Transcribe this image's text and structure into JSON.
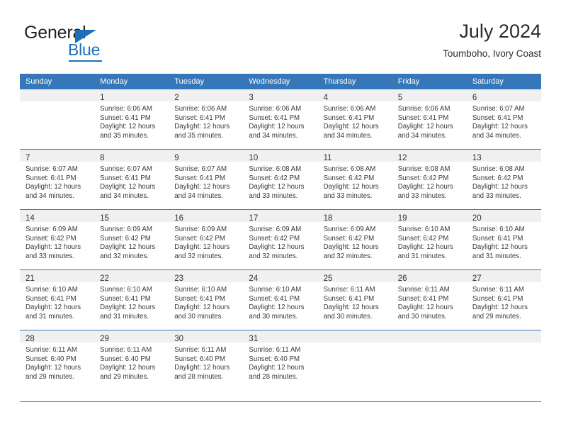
{
  "brand": {
    "name_part1": "General",
    "name_part2": "Blue",
    "logo_icon": "triangle-logo-icon",
    "colors": {
      "blue": "#1d70b7",
      "dark": "#231f20"
    }
  },
  "header": {
    "title": "July 2024",
    "subtitle": "Toumboho, Ivory Coast"
  },
  "calendar": {
    "header_bg": "#3577b9",
    "header_text_color": "#ffffff",
    "daynum_band_bg": "#f0f0f0",
    "weekday_headers": [
      "Sunday",
      "Monday",
      "Tuesday",
      "Wednesday",
      "Thursday",
      "Friday",
      "Saturday"
    ],
    "weeks": [
      [
        {
          "day": "",
          "lines": []
        },
        {
          "day": "1",
          "lines": [
            "Sunrise: 6:06 AM",
            "Sunset: 6:41 PM",
            "Daylight: 12 hours",
            "and 35 minutes."
          ]
        },
        {
          "day": "2",
          "lines": [
            "Sunrise: 6:06 AM",
            "Sunset: 6:41 PM",
            "Daylight: 12 hours",
            "and 35 minutes."
          ]
        },
        {
          "day": "3",
          "lines": [
            "Sunrise: 6:06 AM",
            "Sunset: 6:41 PM",
            "Daylight: 12 hours",
            "and 34 minutes."
          ]
        },
        {
          "day": "4",
          "lines": [
            "Sunrise: 6:06 AM",
            "Sunset: 6:41 PM",
            "Daylight: 12 hours",
            "and 34 minutes."
          ]
        },
        {
          "day": "5",
          "lines": [
            "Sunrise: 6:06 AM",
            "Sunset: 6:41 PM",
            "Daylight: 12 hours",
            "and 34 minutes."
          ]
        },
        {
          "day": "6",
          "lines": [
            "Sunrise: 6:07 AM",
            "Sunset: 6:41 PM",
            "Daylight: 12 hours",
            "and 34 minutes."
          ]
        }
      ],
      [
        {
          "day": "7",
          "lines": [
            "Sunrise: 6:07 AM",
            "Sunset: 6:41 PM",
            "Daylight: 12 hours",
            "and 34 minutes."
          ]
        },
        {
          "day": "8",
          "lines": [
            "Sunrise: 6:07 AM",
            "Sunset: 6:41 PM",
            "Daylight: 12 hours",
            "and 34 minutes."
          ]
        },
        {
          "day": "9",
          "lines": [
            "Sunrise: 6:07 AM",
            "Sunset: 6:41 PM",
            "Daylight: 12 hours",
            "and 34 minutes."
          ]
        },
        {
          "day": "10",
          "lines": [
            "Sunrise: 6:08 AM",
            "Sunset: 6:42 PM",
            "Daylight: 12 hours",
            "and 33 minutes."
          ]
        },
        {
          "day": "11",
          "lines": [
            "Sunrise: 6:08 AM",
            "Sunset: 6:42 PM",
            "Daylight: 12 hours",
            "and 33 minutes."
          ]
        },
        {
          "day": "12",
          "lines": [
            "Sunrise: 6:08 AM",
            "Sunset: 6:42 PM",
            "Daylight: 12 hours",
            "and 33 minutes."
          ]
        },
        {
          "day": "13",
          "lines": [
            "Sunrise: 6:08 AM",
            "Sunset: 6:42 PM",
            "Daylight: 12 hours",
            "and 33 minutes."
          ]
        }
      ],
      [
        {
          "day": "14",
          "lines": [
            "Sunrise: 6:09 AM",
            "Sunset: 6:42 PM",
            "Daylight: 12 hours",
            "and 33 minutes."
          ]
        },
        {
          "day": "15",
          "lines": [
            "Sunrise: 6:09 AM",
            "Sunset: 6:42 PM",
            "Daylight: 12 hours",
            "and 32 minutes."
          ]
        },
        {
          "day": "16",
          "lines": [
            "Sunrise: 6:09 AM",
            "Sunset: 6:42 PM",
            "Daylight: 12 hours",
            "and 32 minutes."
          ]
        },
        {
          "day": "17",
          "lines": [
            "Sunrise: 6:09 AM",
            "Sunset: 6:42 PM",
            "Daylight: 12 hours",
            "and 32 minutes."
          ]
        },
        {
          "day": "18",
          "lines": [
            "Sunrise: 6:09 AM",
            "Sunset: 6:42 PM",
            "Daylight: 12 hours",
            "and 32 minutes."
          ]
        },
        {
          "day": "19",
          "lines": [
            "Sunrise: 6:10 AM",
            "Sunset: 6:42 PM",
            "Daylight: 12 hours",
            "and 31 minutes."
          ]
        },
        {
          "day": "20",
          "lines": [
            "Sunrise: 6:10 AM",
            "Sunset: 6:41 PM",
            "Daylight: 12 hours",
            "and 31 minutes."
          ]
        }
      ],
      [
        {
          "day": "21",
          "lines": [
            "Sunrise: 6:10 AM",
            "Sunset: 6:41 PM",
            "Daylight: 12 hours",
            "and 31 minutes."
          ]
        },
        {
          "day": "22",
          "lines": [
            "Sunrise: 6:10 AM",
            "Sunset: 6:41 PM",
            "Daylight: 12 hours",
            "and 31 minutes."
          ]
        },
        {
          "day": "23",
          "lines": [
            "Sunrise: 6:10 AM",
            "Sunset: 6:41 PM",
            "Daylight: 12 hours",
            "and 30 minutes."
          ]
        },
        {
          "day": "24",
          "lines": [
            "Sunrise: 6:10 AM",
            "Sunset: 6:41 PM",
            "Daylight: 12 hours",
            "and 30 minutes."
          ]
        },
        {
          "day": "25",
          "lines": [
            "Sunrise: 6:11 AM",
            "Sunset: 6:41 PM",
            "Daylight: 12 hours",
            "and 30 minutes."
          ]
        },
        {
          "day": "26",
          "lines": [
            "Sunrise: 6:11 AM",
            "Sunset: 6:41 PM",
            "Daylight: 12 hours",
            "and 30 minutes."
          ]
        },
        {
          "day": "27",
          "lines": [
            "Sunrise: 6:11 AM",
            "Sunset: 6:41 PM",
            "Daylight: 12 hours",
            "and 29 minutes."
          ]
        }
      ],
      [
        {
          "day": "28",
          "lines": [
            "Sunrise: 6:11 AM",
            "Sunset: 6:40 PM",
            "Daylight: 12 hours",
            "and 29 minutes."
          ]
        },
        {
          "day": "29",
          "lines": [
            "Sunrise: 6:11 AM",
            "Sunset: 6:40 PM",
            "Daylight: 12 hours",
            "and 29 minutes."
          ]
        },
        {
          "day": "30",
          "lines": [
            "Sunrise: 6:11 AM",
            "Sunset: 6:40 PM",
            "Daylight: 12 hours",
            "and 28 minutes."
          ]
        },
        {
          "day": "31",
          "lines": [
            "Sunrise: 6:11 AM",
            "Sunset: 6:40 PM",
            "Daylight: 12 hours",
            "and 28 minutes."
          ]
        },
        {
          "day": "",
          "lines": []
        },
        {
          "day": "",
          "lines": []
        },
        {
          "day": "",
          "lines": []
        }
      ]
    ]
  }
}
